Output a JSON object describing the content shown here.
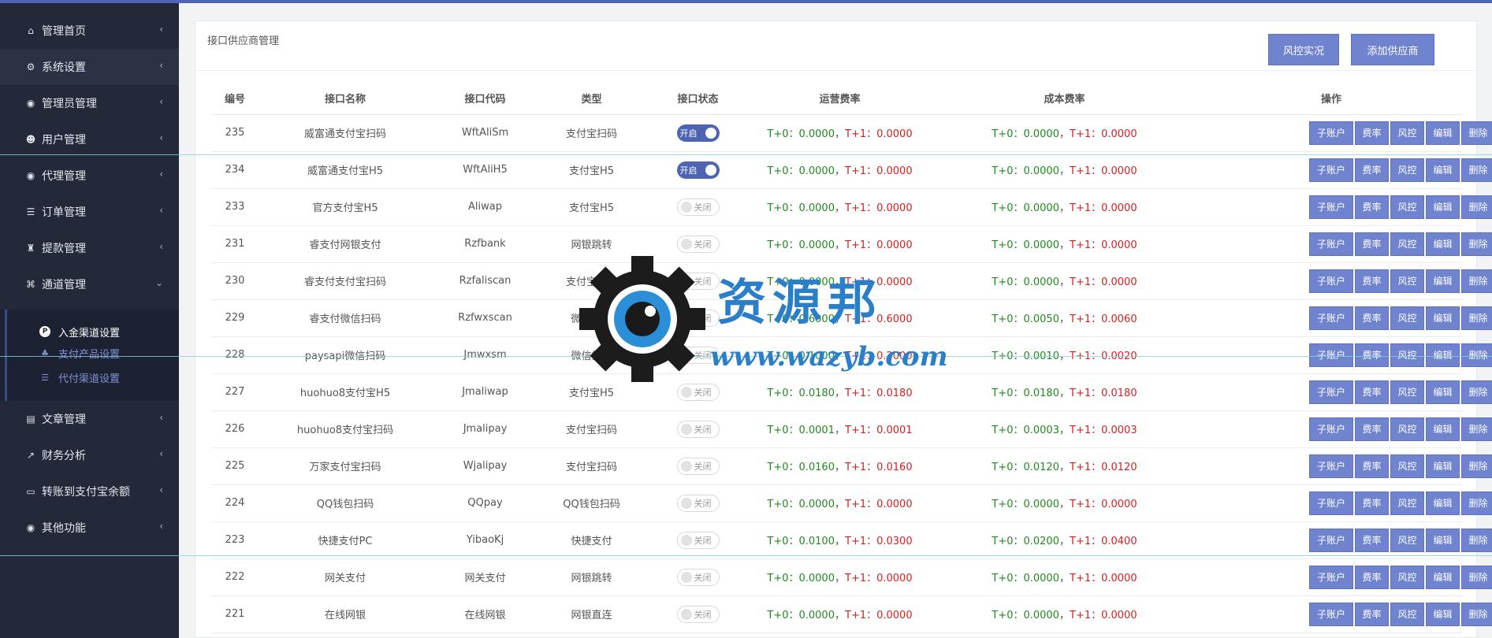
{
  "sidebar": {
    "items": [
      {
        "label": "管理首页",
        "icon": "home-icon",
        "chev": "‹"
      },
      {
        "label": "系统设置",
        "icon": "gears-icon",
        "chev": "‹"
      },
      {
        "label": "管理员管理",
        "icon": "user-circle-icon",
        "chev": "‹"
      },
      {
        "label": "用户管理",
        "icon": "users-icon",
        "chev": "‹"
      },
      {
        "label": "代理管理",
        "icon": "user-circle-icon",
        "chev": "‹"
      },
      {
        "label": "订单管理",
        "icon": "list-icon",
        "chev": "‹"
      },
      {
        "label": "提款管理",
        "icon": "bag-icon",
        "chev": "‹"
      },
      {
        "label": "通道管理",
        "icon": "bank-icon",
        "chev": "⌄"
      },
      {
        "label": "文章管理",
        "icon": "book-icon",
        "chev": "‹"
      },
      {
        "label": "财务分析",
        "icon": "line-chart-icon",
        "chev": "‹"
      },
      {
        "label": "转账到支付宝余额",
        "icon": "card-icon",
        "chev": "‹"
      },
      {
        "label": "其他功能",
        "icon": "user-circle-icon",
        "chev": "‹"
      }
    ],
    "submenu": [
      {
        "label": "入金渠道设置",
        "icon": "p-circle-icon",
        "glyph": "P"
      },
      {
        "label": "支付产品设置",
        "icon": "sitemap-icon",
        "glyph": "♣"
      },
      {
        "label": "代付渠道设置",
        "icon": "sliders-icon",
        "glyph": "☰"
      }
    ]
  },
  "main": {
    "title": "接口供应商管理",
    "btn_risk": "风控实况",
    "btn_add": "添加供应商",
    "columns": [
      "编号",
      "接口名称",
      "接口代码",
      "类型",
      "接口状态",
      "运营费率",
      "成本费率",
      "操作"
    ],
    "ops": [
      "子账户",
      "费率",
      "风控",
      "编辑",
      "删除"
    ],
    "t0_label": "T+0：",
    "t1_label": "T+1：",
    "sep": "，",
    "rows": [
      {
        "id": "235",
        "name": "威富通支付宝扫码",
        "code": "WftAliSm",
        "type": "支付宝扫码",
        "status": "开启",
        "on": true,
        "op_t0": "0.0000",
        "op_t1": "0.0000",
        "cost_t0": "0.0000",
        "cost_t1": "0.0000"
      },
      {
        "id": "234",
        "name": "威富通支付宝H5",
        "code": "WftAliH5",
        "type": "支付宝H5",
        "status": "开启",
        "on": true,
        "op_t0": "0.0000",
        "op_t1": "0.0000",
        "cost_t0": "0.0000",
        "cost_t1": "0.0000"
      },
      {
        "id": "233",
        "name": "官方支付宝H5",
        "code": "Aliwap",
        "type": "支付宝H5",
        "status": "关闭",
        "on": false,
        "op_t0": "0.0000",
        "op_t1": "0.0000",
        "cost_t0": "0.0000",
        "cost_t1": "0.0000"
      },
      {
        "id": "231",
        "name": "睿支付网银支付",
        "code": "Rzfbank",
        "type": "网银跳转",
        "status": "关闭",
        "on": false,
        "op_t0": "0.0000",
        "op_t1": "0.0000",
        "cost_t0": "0.0000",
        "cost_t1": "0.0000"
      },
      {
        "id": "230",
        "name": "睿支付支付宝扫码",
        "code": "Rzfaliscan",
        "type": "支付宝扫码",
        "status": "关闭",
        "on": false,
        "op_t0": "0.0000",
        "op_t1": "0.0000",
        "cost_t0": "0.0000",
        "cost_t1": "0.0000"
      },
      {
        "id": "229",
        "name": "睿支付微信扫码",
        "code": "Rzfwxscan",
        "type": "微信扫码",
        "status": "关闭",
        "on": false,
        "op_t0": "0.6000",
        "op_t1": "0.6000",
        "cost_t0": "0.0050",
        "cost_t1": "0.0060"
      },
      {
        "id": "228",
        "name": "paysapi微信扫码",
        "code": "Jmwxsm",
        "type": "微信扫码",
        "status": "关闭",
        "on": false,
        "op_t0": "0.1000",
        "op_t1": "0.2000",
        "cost_t0": "0.0010",
        "cost_t1": "0.0020"
      },
      {
        "id": "227",
        "name": "huohuo8支付宝H5",
        "code": "Jmaliwap",
        "type": "支付宝H5",
        "status": "关闭",
        "on": false,
        "op_t0": "0.0180",
        "op_t1": "0.0180",
        "cost_t0": "0.0180",
        "cost_t1": "0.0180"
      },
      {
        "id": "226",
        "name": "huohuo8支付宝扫码",
        "code": "Jmalipay",
        "type": "支付宝扫码",
        "status": "关闭",
        "on": false,
        "op_t0": "0.0001",
        "op_t1": "0.0001",
        "cost_t0": "0.0003",
        "cost_t1": "0.0003"
      },
      {
        "id": "225",
        "name": "万家支付宝扫码",
        "code": "Wjalipay",
        "type": "支付宝扫码",
        "status": "关闭",
        "on": false,
        "op_t0": "0.0160",
        "op_t1": "0.0160",
        "cost_t0": "0.0120",
        "cost_t1": "0.0120"
      },
      {
        "id": "224",
        "name": "QQ钱包扫码",
        "code": "QQpay",
        "type": "QQ钱包扫码",
        "status": "关闭",
        "on": false,
        "op_t0": "0.0000",
        "op_t1": "0.0000",
        "cost_t0": "0.0000",
        "cost_t1": "0.0000"
      },
      {
        "id": "223",
        "name": "快捷支付PC",
        "code": "YibaoKj",
        "type": "快捷支付",
        "status": "关闭",
        "on": false,
        "op_t0": "0.0100",
        "op_t1": "0.0300",
        "cost_t0": "0.0200",
        "cost_t1": "0.0400"
      },
      {
        "id": "222",
        "name": "网关支付",
        "code": "网关支付",
        "type": "网银跳转",
        "status": "关闭",
        "on": false,
        "op_t0": "0.0000",
        "op_t1": "0.0000",
        "cost_t0": "0.0000",
        "cost_t1": "0.0000"
      },
      {
        "id": "221",
        "name": "在线网银",
        "code": "在线网银",
        "type": "网银直连",
        "status": "关闭",
        "on": false,
        "op_t0": "0.0000",
        "op_t1": "0.0000",
        "cost_t0": "0.0000",
        "cost_t1": "0.0000"
      }
    ]
  },
  "watermark": {
    "text": "资源邦",
    "url": "www.wazyb.com"
  },
  "colors": {
    "accent": "#4f63b3",
    "button": "#6f83cf",
    "sidebar": "#232939",
    "t0": "#1f8a1f",
    "t1": "#d62020"
  }
}
